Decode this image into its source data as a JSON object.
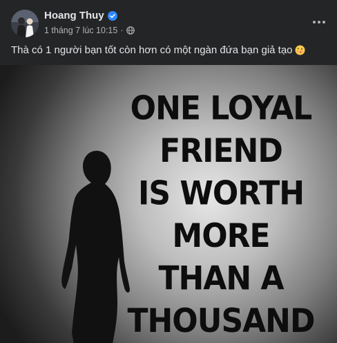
{
  "post": {
    "author": "Hoang Thuy",
    "timestamp": "1 tháng 7 lúc 10:15",
    "separator": "·",
    "caption": "Thà có 1 người bạn tốt còn hơn có một ngàn đứa bạn giả tạo",
    "caption_emoji": "kissing-face-emoji",
    "more_icon": "more-horizontal-icon",
    "privacy_icon": "globe-icon",
    "verified_icon": "verified-badge-icon",
    "colors": {
      "background": "#242526",
      "text_primary": "#e4e6eb",
      "text_secondary": "#b0b3b8",
      "verified": "#2d88ff"
    }
  },
  "image": {
    "lines": [
      "ONE LOYAL",
      "FRIEND",
      "IS WORTH",
      "MORE",
      "THAN A",
      "THOUSAND"
    ]
  }
}
